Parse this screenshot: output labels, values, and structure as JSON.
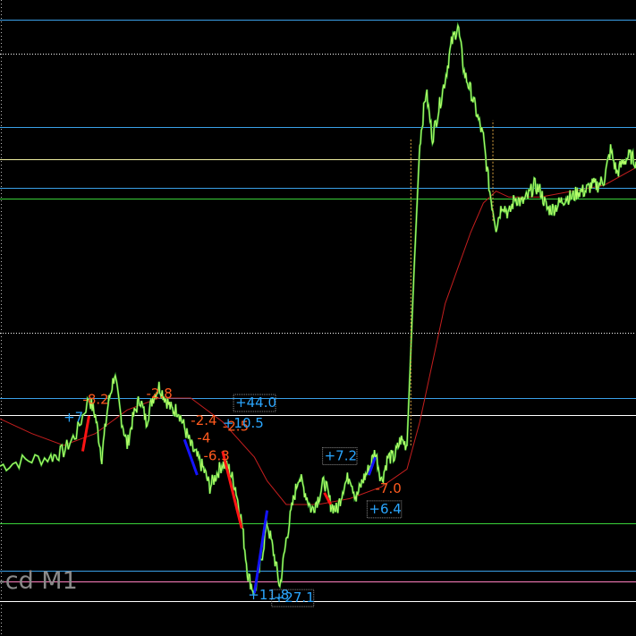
{
  "window": {
    "symbol_label": "-cd M1"
  },
  "colors": {
    "background": "#000000",
    "price": "#b8ff6a",
    "price_dark": "#2f9e2f",
    "moving_average": "#c41e1e",
    "level_blue": "#3aa0e8",
    "level_white": "#ffffff",
    "level_yellow": "#f0f0a0",
    "level_green": "#3ad23a",
    "level_pink": "#ff80c0",
    "label_buy": "#2aa6ff",
    "label_sell": "#ff5a1e",
    "trade_buy_segment": "#1414ff",
    "trade_sell_segment": "#ff1414"
  },
  "chart_data": {
    "type": "line",
    "timeframe": "M1",
    "y_range": [
      0,
      100
    ],
    "x_range": [
      0,
      100
    ],
    "grid": false,
    "series": [
      {
        "kind": "price",
        "points": [
          [
            0,
            24.5
          ],
          [
            4,
            25.5
          ],
          [
            8,
            26
          ],
          [
            10,
            27
          ],
          [
            12,
            30
          ],
          [
            14,
            36
          ],
          [
            15,
            33
          ],
          [
            16,
            26
          ],
          [
            17,
            35
          ],
          [
            18,
            40
          ],
          [
            19,
            33
          ],
          [
            20,
            28
          ],
          [
            21,
            33
          ],
          [
            22,
            36
          ],
          [
            23,
            32
          ],
          [
            24,
            36
          ],
          [
            25,
            38
          ],
          [
            26,
            36
          ],
          [
            27,
            34
          ],
          [
            28,
            34
          ],
          [
            29,
            31
          ],
          [
            30,
            28
          ],
          [
            31,
            26
          ],
          [
            32,
            24
          ],
          [
            33,
            21
          ],
          [
            34,
            23
          ],
          [
            35,
            25
          ],
          [
            36,
            24
          ],
          [
            37,
            21
          ],
          [
            38,
            15
          ],
          [
            39,
            6
          ],
          [
            40,
            3
          ],
          [
            41,
            8
          ],
          [
            42,
            15
          ],
          [
            43,
            10
          ],
          [
            44,
            4
          ],
          [
            45,
            12
          ],
          [
            46,
            18
          ],
          [
            47,
            23
          ],
          [
            48,
            20
          ],
          [
            49,
            17
          ],
          [
            50,
            19
          ],
          [
            51,
            22
          ],
          [
            52,
            18
          ],
          [
            53,
            17
          ],
          [
            54,
            21
          ],
          [
            55,
            23
          ],
          [
            56,
            19
          ],
          [
            57,
            22
          ],
          [
            58,
            24
          ],
          [
            59,
            27
          ],
          [
            60,
            22
          ],
          [
            61,
            26
          ],
          [
            62,
            26
          ],
          [
            63,
            29
          ],
          [
            64,
            28
          ],
          [
            65,
            55
          ],
          [
            66,
            79
          ],
          [
            67,
            88
          ],
          [
            68,
            80
          ],
          [
            69,
            85
          ],
          [
            70,
            90
          ],
          [
            71,
            96
          ],
          [
            72,
            99
          ],
          [
            73,
            91
          ],
          [
            74,
            88
          ],
          [
            75,
            84
          ],
          [
            76,
            80
          ],
          [
            77,
            71
          ],
          [
            78,
            65
          ],
          [
            79,
            69
          ],
          [
            80,
            67
          ],
          [
            81,
            70
          ],
          [
            82,
            69
          ],
          [
            83,
            70
          ],
          [
            84,
            72
          ],
          [
            85,
            71
          ],
          [
            86,
            68
          ],
          [
            87,
            68
          ],
          [
            88,
            69
          ],
          [
            89,
            70
          ],
          [
            90,
            70
          ],
          [
            91,
            71
          ],
          [
            92,
            71
          ],
          [
            93,
            72
          ],
          [
            94,
            72
          ],
          [
            95,
            73
          ],
          [
            96,
            78
          ],
          [
            97,
            74
          ],
          [
            98,
            76
          ],
          [
            99,
            77
          ],
          [
            100,
            76
          ]
        ]
      },
      {
        "kind": "moving-average",
        "points": [
          [
            0,
            32.5
          ],
          [
            5,
            30
          ],
          [
            10,
            28
          ],
          [
            15,
            30
          ],
          [
            20,
            34
          ],
          [
            25,
            36
          ],
          [
            30,
            36
          ],
          [
            35,
            32
          ],
          [
            40,
            26
          ],
          [
            42,
            22
          ],
          [
            45,
            18
          ],
          [
            50,
            18
          ],
          [
            55,
            19
          ],
          [
            60,
            21
          ],
          [
            64,
            24
          ],
          [
            66,
            32
          ],
          [
            68,
            42
          ],
          [
            70,
            52
          ],
          [
            72,
            58
          ],
          [
            74,
            64
          ],
          [
            76,
            69
          ],
          [
            78,
            71
          ],
          [
            80,
            70
          ],
          [
            85,
            70
          ],
          [
            90,
            71
          ],
          [
            95,
            72
          ],
          [
            100,
            75
          ]
        ]
      }
    ],
    "levels": [
      {
        "y": 100,
        "color_key": "level_blue",
        "style": "solid"
      },
      {
        "y": 94.3,
        "color_key": "level_white",
        "style": "dotted"
      },
      {
        "y": 81.8,
        "color_key": "level_blue",
        "style": "solid"
      },
      {
        "y": 76.4,
        "color_key": "level_yellow",
        "style": "solid"
      },
      {
        "y": 71.6,
        "color_key": "level_blue",
        "style": "solid"
      },
      {
        "y": 69.8,
        "color_key": "level_green",
        "style": "solid"
      },
      {
        "y": 47.0,
        "color_key": "level_white",
        "style": "dotted"
      },
      {
        "y": 36.0,
        "color_key": "level_blue",
        "style": "solid"
      },
      {
        "y": 33.1,
        "color_key": "level_white",
        "style": "solid"
      },
      {
        "y": 14.9,
        "color_key": "level_green",
        "style": "solid"
      },
      {
        "y": 6.8,
        "color_key": "level_blue",
        "style": "solid"
      },
      {
        "y": 5.0,
        "color_key": "level_pink",
        "style": "solid"
      },
      {
        "y": 1.6,
        "color_key": "level_white",
        "style": "solid"
      }
    ],
    "trade_segments": [
      {
        "from": [
          13,
          27
        ],
        "to": [
          14,
          33
        ],
        "color_key": "trade_sell_segment"
      },
      {
        "from": [
          29,
          29
        ],
        "to": [
          31,
          23
        ],
        "color_key": "trade_buy_segment"
      },
      {
        "from": [
          35,
          27
        ],
        "to": [
          38,
          14
        ],
        "color_key": "trade_sell_segment"
      },
      {
        "from": [
          40,
          3
        ],
        "to": [
          42,
          17
        ],
        "color_key": "trade_buy_segment"
      },
      {
        "from": [
          58,
          23
        ],
        "to": [
          59,
          26
        ],
        "color_key": "trade_buy_segment"
      },
      {
        "from": [
          51,
          20
        ],
        "to": [
          52,
          18
        ],
        "color_key": "trade_sell_segment"
      }
    ],
    "trade_labels": [
      {
        "text": "+7",
        "x": 10,
        "y": 32,
        "side": "buy",
        "boxed": false
      },
      {
        "text": "-8.2",
        "x": 13,
        "y": 35,
        "side": "sell",
        "boxed": false
      },
      {
        "text": "-2.8",
        "x": 23,
        "y": 36,
        "side": "sell",
        "boxed": false
      },
      {
        "text": "+44.0",
        "x": 37,
        "y": 34.5,
        "side": "buy",
        "boxed": true
      },
      {
        "text": "-2.4",
        "x": 30,
        "y": 31.5,
        "side": "sell",
        "boxed": false
      },
      {
        "text": "-2.5",
        "x": 35,
        "y": 30.5,
        "side": "sell",
        "boxed": false
      },
      {
        "text": "+10.5",
        "x": 35,
        "y": 31,
        "side": "buy",
        "boxed": false
      },
      {
        "text": "-4",
        "x": 31,
        "y": 28.5,
        "side": "sell",
        "boxed": false
      },
      {
        "text": "-6.3",
        "x": 32,
        "y": 25.5,
        "side": "sell",
        "boxed": false
      },
      {
        "text": "+7.2",
        "x": 51,
        "y": 25.5,
        "side": "buy",
        "boxed": true
      },
      {
        "text": "-7.0",
        "x": 59,
        "y": 20,
        "side": "sell",
        "boxed": false
      },
      {
        "text": "+6.4",
        "x": 58,
        "y": 16.5,
        "side": "buy",
        "boxed": true
      },
      {
        "text": "+11.8",
        "x": 39,
        "y": 2,
        "side": "buy",
        "boxed": false
      },
      {
        "text": "+27.1",
        "x": 43,
        "y": 1.5,
        "side": "buy",
        "boxed": true
      }
    ]
  }
}
